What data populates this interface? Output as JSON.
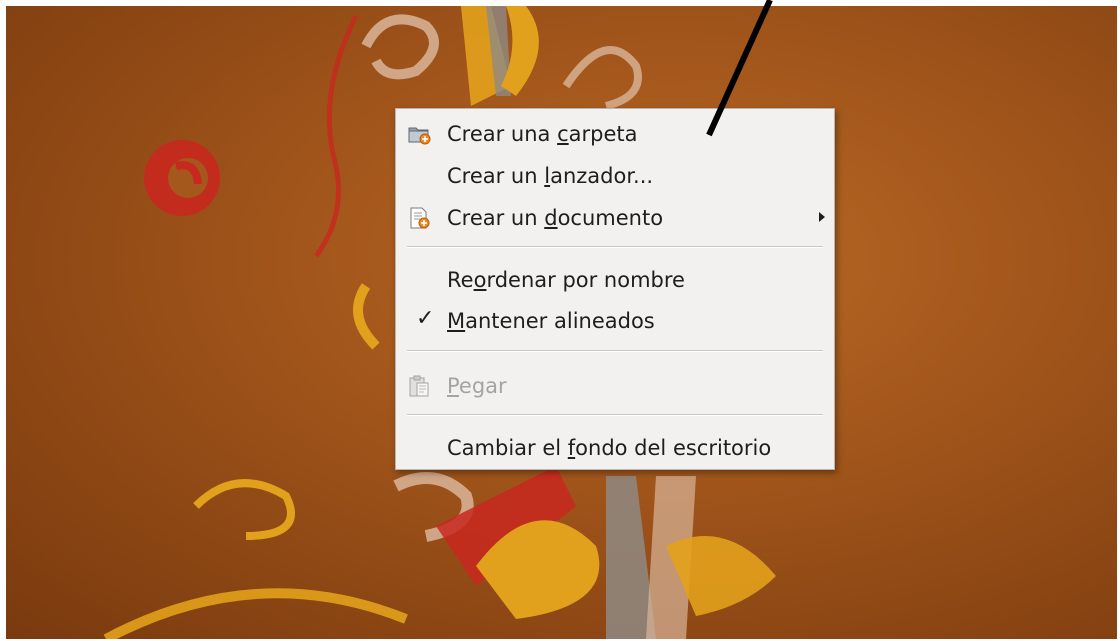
{
  "context_menu": {
    "items": [
      {
        "label_pre": "Crear una ",
        "mnemonic": "c",
        "label_post": "arpeta",
        "icon": "folder-new-icon"
      },
      {
        "label_pre": "Crear un ",
        "mnemonic": "l",
        "label_post": "anzador...",
        "icon": ""
      },
      {
        "label_pre": "Crear un ",
        "mnemonic": "d",
        "label_post": "ocumento",
        "icon": "document-new-icon",
        "submenu": true
      },
      {
        "label_pre": "Re",
        "mnemonic": "o",
        "label_post": "rdenar por nombre"
      },
      {
        "label_pre": "",
        "mnemonic": "M",
        "label_post": "antener alineados",
        "checked": true,
        "check_mark": "✓"
      },
      {
        "label_pre": "",
        "mnemonic": "P",
        "label_post": "egar",
        "icon": "paste-icon",
        "disabled": true
      },
      {
        "label_pre": "Cambiar el ",
        "mnemonic": "f",
        "label_post": "ondo del escritorio"
      }
    ]
  },
  "colors": {
    "desktop_background": "#a5581c",
    "menu_background": "#f2f1ef",
    "disabled_text": "#a6a49f"
  }
}
